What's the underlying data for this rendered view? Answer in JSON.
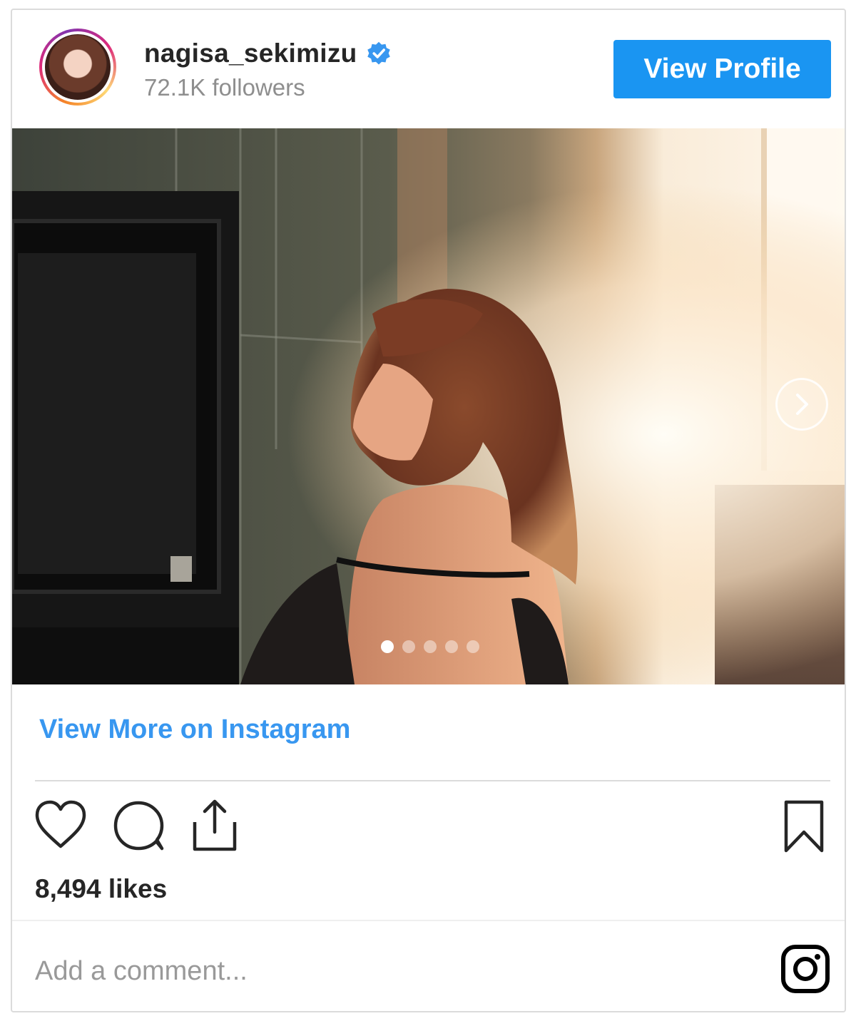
{
  "header": {
    "username": "nagisa_sekimizu",
    "followers": "72.1K followers",
    "view_profile_label": "View Profile",
    "verified_icon": "verified-badge-icon"
  },
  "media": {
    "carousel_count": 5,
    "active_index": 0,
    "next_icon": "chevron-right-icon"
  },
  "links": {
    "view_more": "View More on Instagram"
  },
  "actions": {
    "like_icon": "heart-icon",
    "comment_icon": "comment-icon",
    "share_icon": "share-icon",
    "save_icon": "bookmark-icon"
  },
  "likes": "8,494 likes",
  "comment": {
    "placeholder": "Add a comment..."
  },
  "colors": {
    "accent_button": "#1a95f2",
    "link": "#3897f0",
    "verified": "#3897f0",
    "text_primary": "#262626",
    "text_secondary": "#8e8e8e"
  }
}
